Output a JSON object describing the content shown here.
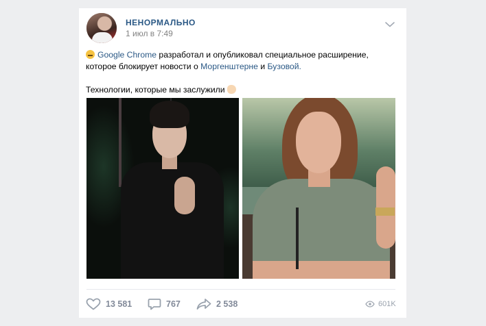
{
  "post": {
    "channel_name": "НЕНОРМАЛЬНО",
    "time": "1 июл в 7:49",
    "text": {
      "emoji_start": "zipper-mouth-face-emoji",
      "link_chrome": "Google Chrome",
      "part1": " разработал и опубликовал специальное расширение,",
      "part2": "которое блокирует новости о ",
      "link_morgenshtern": "Моргенштерне",
      "and": " и ",
      "link_buzova": "Бузовой.",
      "line2": "Технологии, которые мы заслужили",
      "emoji_end": "clapping-hands-emoji"
    },
    "photos": [
      "photo-left",
      "photo-right"
    ]
  },
  "actions": {
    "likes": "13 581",
    "comments": "767",
    "shares": "2 538",
    "views": "601K"
  },
  "colors": {
    "link": "#2a5885",
    "meta": "#828282",
    "action": "#828a99",
    "background": "#edeef0"
  }
}
